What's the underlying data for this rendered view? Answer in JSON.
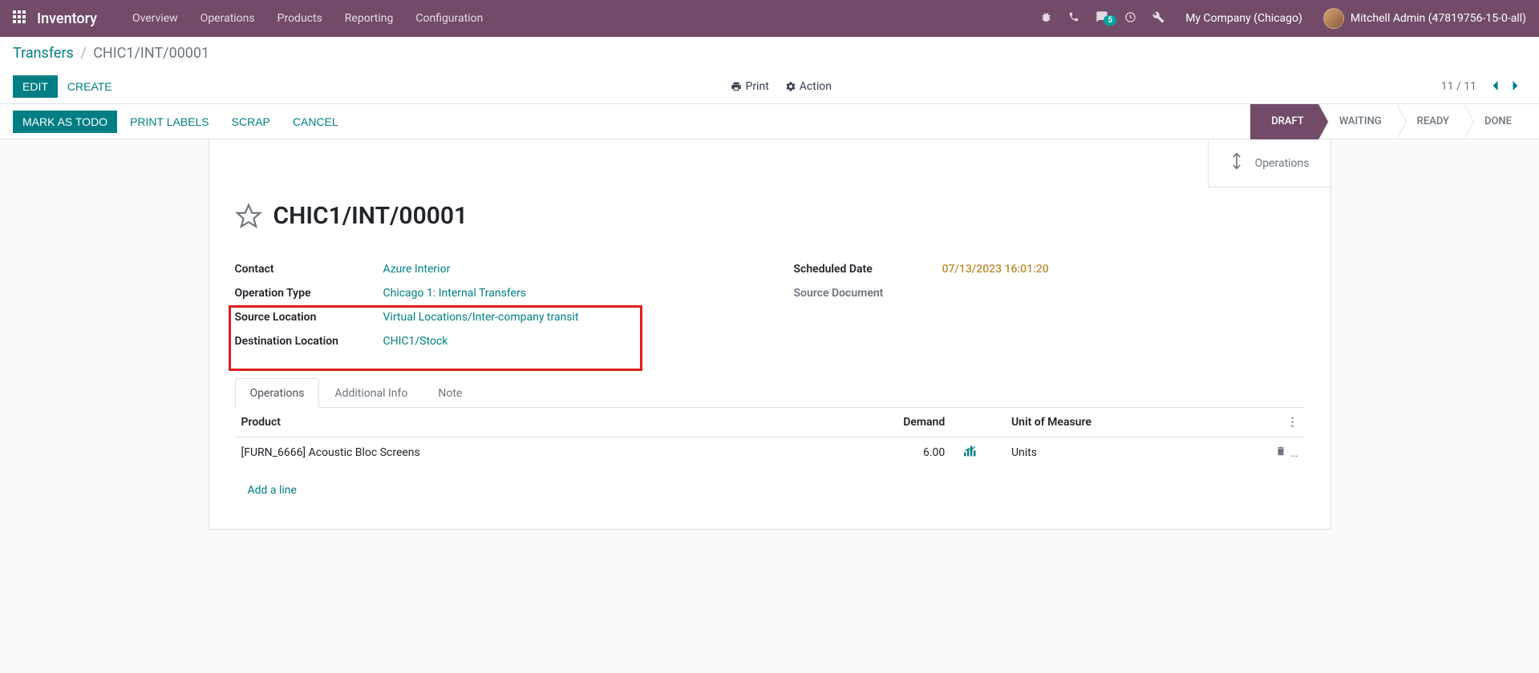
{
  "navbar": {
    "brand": "Inventory",
    "menu": [
      "Overview",
      "Operations",
      "Products",
      "Reporting",
      "Configuration"
    ],
    "msg_badge": "5",
    "company": "My Company (Chicago)",
    "user": "Mitchell Admin (47819756-15-0-all)"
  },
  "breadcrumb": {
    "parent": "Transfers",
    "current": "CHIC1/INT/00001"
  },
  "controls": {
    "edit": "Edit",
    "create": "Create",
    "print": "Print",
    "action": "Action",
    "pager": "11 / 11"
  },
  "status_actions": {
    "mark_todo": "Mark as Todo",
    "print_labels": "Print Labels",
    "scrap": "Scrap",
    "cancel": "Cancel"
  },
  "status_steps": [
    "Draft",
    "Waiting",
    "Ready",
    "Done"
  ],
  "sheet": {
    "operations_btn": "Operations",
    "title": "CHIC1/INT/00001",
    "left": {
      "contact_label": "Contact",
      "contact_value": "Azure Interior",
      "optype_label": "Operation Type",
      "optype_value": "Chicago 1: Internal Transfers",
      "srcloc_label": "Source Location",
      "srcloc_value": "Virtual Locations/Inter-company transit",
      "dstloc_label": "Destination Location",
      "dstloc_value": "CHIC1/Stock"
    },
    "right": {
      "sched_label": "Scheduled Date",
      "sched_value": "07/13/2023 16:01:20",
      "srcdoc_label": "Source Document",
      "srcdoc_value": ""
    }
  },
  "tabs": [
    "Operations",
    "Additional Info",
    "Note"
  ],
  "table": {
    "cols": {
      "product": "Product",
      "demand": "Demand",
      "uom": "Unit of Measure"
    },
    "row": {
      "product": "[FURN_6666] Acoustic Bloc Screens",
      "demand": "6.00",
      "uom": "Units"
    },
    "addline": "Add a line"
  }
}
